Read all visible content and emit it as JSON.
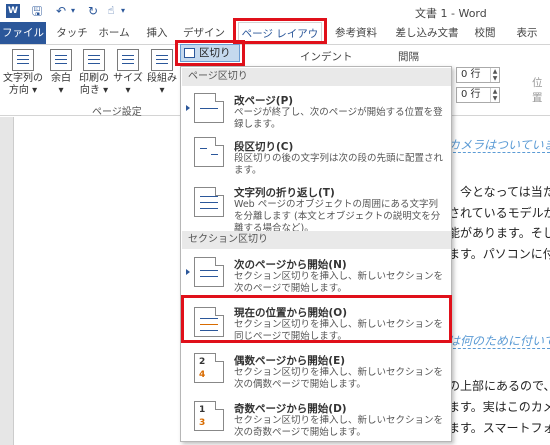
{
  "app": {
    "title": "文書 1 - Word",
    "logo": "W"
  },
  "quick_access": {
    "save": "🖫",
    "undo": "↶",
    "redo": "↻",
    "customize": "▾"
  },
  "tabs": [
    "ファイル",
    "タッチ",
    "ホーム",
    "挿入",
    "デザイン",
    "ページ レイアウト",
    "参考資料",
    "差し込み文書",
    "校閲",
    "表示"
  ],
  "ribbon": {
    "buttons": [
      {
        "line1": "文字列の",
        "line2": "方向 ▾"
      },
      {
        "line1": "余白",
        "line2": "▾"
      },
      {
        "line1": "印刷の",
        "line2": "向き ▾"
      },
      {
        "line1": "サイズ",
        "line2": "▾"
      },
      {
        "line1": "段組み",
        "line2": "▾"
      }
    ],
    "group_label": "ページ設定",
    "breaks_button": "区切り ▾",
    "indent_label": "インデント",
    "spacing_label": "間隔",
    "spin_before": "0 行",
    "spin_after": "0 行",
    "position_label": "位置"
  },
  "menu": {
    "page_breaks_header": "ページ区切り",
    "section_breaks_header": "セクション区切り",
    "items": [
      {
        "title": "改ページ(P)",
        "desc": "ページが終了し、次のページが開始する位置を登録します。"
      },
      {
        "title": "段区切り(C)",
        "desc": "段区切りの後の文字列は次の段の先頭に配置されます。"
      },
      {
        "title": "文字列の折り返し(T)",
        "desc": "Web ページのオブジェクトの周囲にある文字列を分離します (本文とオブジェクトの説明文を分離する場合など)。"
      },
      {
        "title": "次のページから開始(N)",
        "desc": "セクション区切りを挿入し、新しいセクションを次のページで開始します。"
      },
      {
        "title": "現在の位置から開始(O)",
        "desc": "セクション区切りを挿入し、新しいセクションを同じページで開始します。"
      },
      {
        "title": "偶数ページから開始(E)",
        "desc": "セクション区切りを挿入し、新しいセクションを次の偶数ページで開始します。"
      },
      {
        "title": "奇数ページから開始(D)",
        "desc": "セクション区切りを挿入し、新しいセクションを次の奇数ページで開始します。"
      }
    ],
    "icon_numbers": {
      "even_top": "2",
      "even_bottom": "4",
      "odd_top": "1",
      "odd_bottom": "3"
    }
  },
  "document": {
    "lines": [
      "カメラはついていま",
      "、今となっては当た",
      "されているモデルが",
      "能があります。そし",
      "ます。パソコンに付",
      "は何のために付いて",
      "の上部にあるので、ハ",
      "ます。実はこのカメ",
      "ます。スマートフォン"
    ]
  },
  "colors": {
    "accent": "#2b579a",
    "highlight_border": "#e0101a"
  }
}
